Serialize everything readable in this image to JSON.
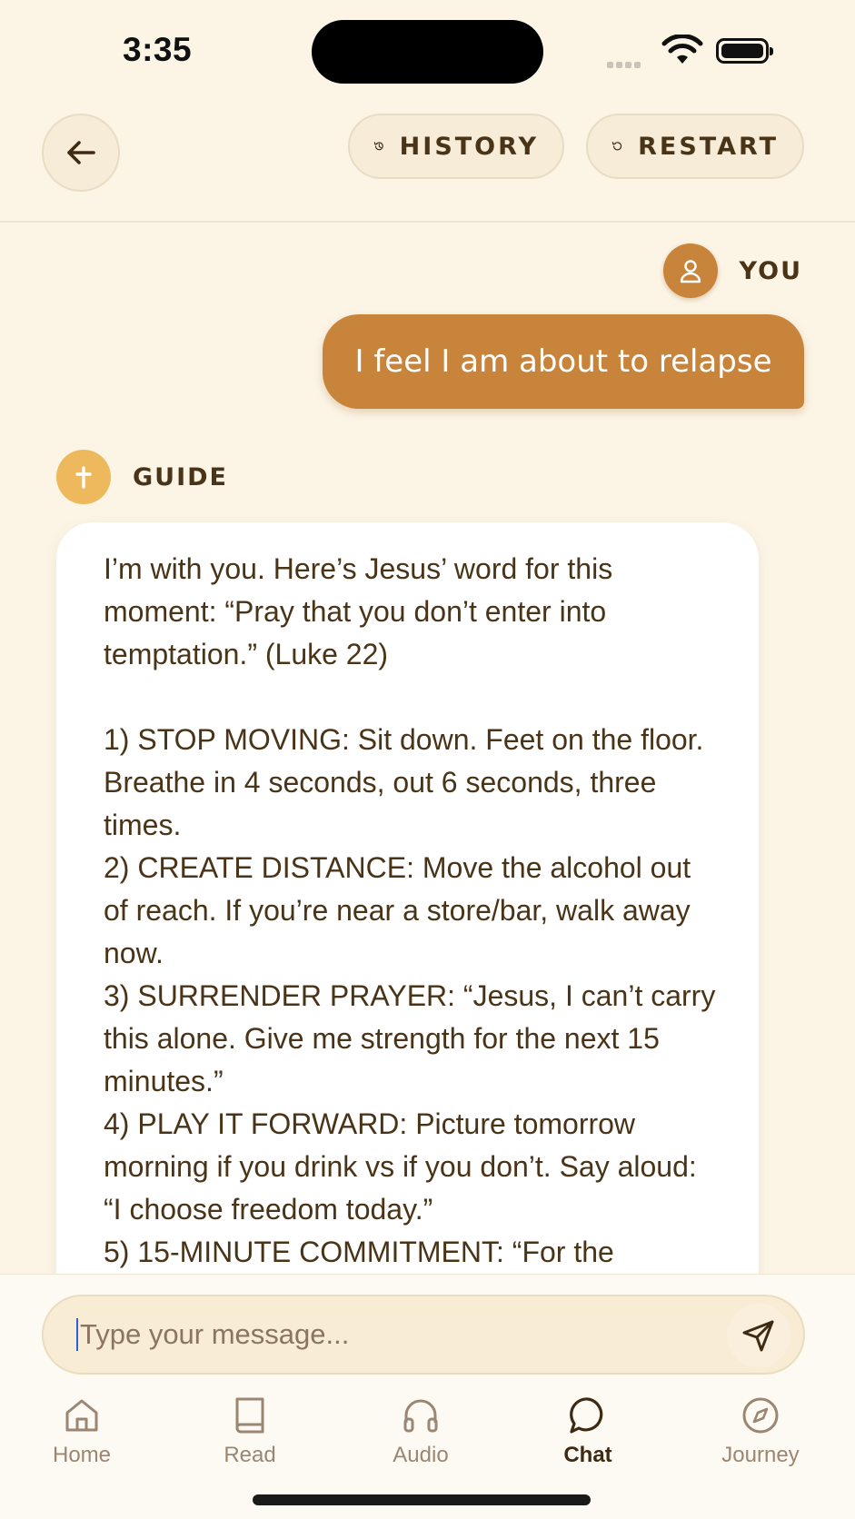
{
  "status_bar": {
    "time": "3:35"
  },
  "nav": {
    "history_label": "HISTORY",
    "restart_label": "RESTART"
  },
  "chat": {
    "user_label": "YOU",
    "user_message": "I feel I am about to relapse",
    "guide_label": "GUIDE",
    "guide_message": "I’m with you. Here’s Jesus’ word for this moment: “Pray that you don’t enter into temptation.” (Luke 22)\n\n1) STOP MOVING: Sit down. Feet on the floor. Breathe in 4 seconds, out 6 seconds, three times.\n2) CREATE DISTANCE: Move the alcohol out of reach. If you’re near a store/bar, walk away now.\n3) SURRENDER PRAYER: “Jesus, I can’t carry this alone. Give me strength for the next 15 minutes.”\n4) PLAY IT FORWARD: Picture tomorrow morning if you drink vs if you don’t. Say aloud: “I choose freedom today.”\n5) 15-MINUTE COMMITMENT: “For the"
  },
  "input": {
    "placeholder": "Type your message..."
  },
  "tabs": [
    {
      "label": "Home",
      "icon": "home-icon"
    },
    {
      "label": "Read",
      "icon": "book-icon"
    },
    {
      "label": "Audio",
      "icon": "headphones-icon"
    },
    {
      "label": "Chat",
      "icon": "chat-bubble-icon",
      "active": true
    },
    {
      "label": "Journey",
      "icon": "compass-icon"
    }
  ],
  "colors": {
    "background": "#fcf5e6",
    "accent": "#c8843a",
    "guide_avatar": "#edb95c",
    "text": "#4a3418"
  }
}
